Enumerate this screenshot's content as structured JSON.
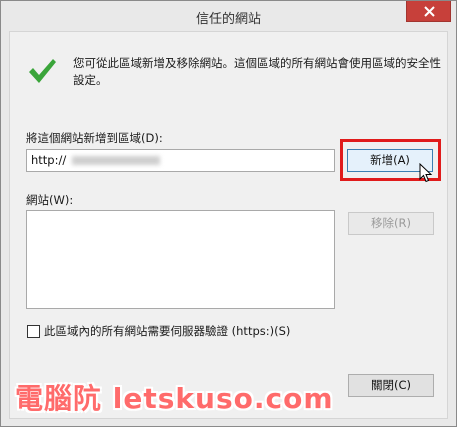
{
  "window": {
    "title": "信任的網站"
  },
  "info": {
    "text": "您可從此區域新增及移除網站。這個區域的所有網站會使用區域的安全性設定。"
  },
  "add_section": {
    "label": "將這個網站新增到區域(D):",
    "input_value": "http://",
    "add_button": "新增(A)"
  },
  "sites": {
    "label": "網站(W):",
    "items": [],
    "remove_button": "移除(R)"
  },
  "https_option": {
    "label": "此區域內的所有網站需要伺服器驗證 (https:)(S)",
    "checked": false
  },
  "footer": {
    "close_button": "關閉(C)"
  },
  "watermark": {
    "text": "電腦阬 letskuso.com"
  },
  "colors": {
    "close_red": "#c7403a",
    "highlight_red": "#e01b1b",
    "check_green": "#3aa53a"
  }
}
